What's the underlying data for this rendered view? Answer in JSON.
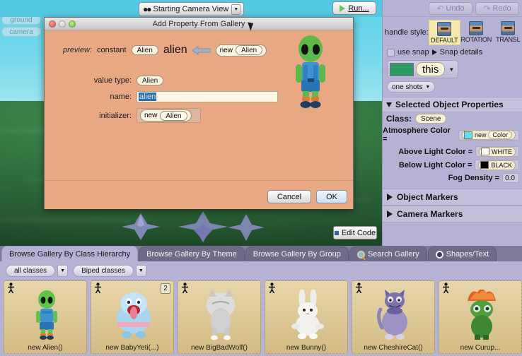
{
  "scene": {
    "object_tree": [
      {
        "label": "this",
        "active": true
      },
      {
        "label": "ground",
        "active": false
      },
      {
        "label": "camera",
        "active": false
      }
    ],
    "camera_view_label": "Starting Camera View",
    "camera_icon": "binoculars-icon",
    "run_label": "Run...",
    "run_icon": "play-triangle-icon",
    "edit_code_label": "Edit Code",
    "ground_color": "#2f6b3c",
    "sky_color": "#63d4e8",
    "prop_color": "#8e90c8"
  },
  "right_panel": {
    "undo_label": "Undo",
    "redo_label": "Redo",
    "undo_icon": "undo-arrow-icon",
    "redo_icon": "redo-arrow-icon",
    "handle_style_label": "handle style:",
    "handle_styles": [
      {
        "label": "DEFAULT",
        "selected": true
      },
      {
        "label": "ROTATION",
        "selected": false
      },
      {
        "label": "TRANSL",
        "selected": false
      }
    ],
    "use_snap_label": "use snap",
    "snap_details_label": "Snap details",
    "this_label": "this",
    "this_swatch": "#2f9a62",
    "one_shots_label": "one shots",
    "selected_object_properties_label": "Selected Object Properties",
    "class_label": "Class:",
    "class_value": "Scene",
    "properties": [
      {
        "label": "Atmosphere Color =",
        "kind": "color_new",
        "swatch": "#66dcf4",
        "value": "new",
        "sub": "Color"
      },
      {
        "label": "Above Light Color =",
        "kind": "color",
        "swatch": "#ffffff",
        "value": "WHITE"
      },
      {
        "label": "Below Light Color =",
        "kind": "color",
        "swatch": "#000000",
        "value": "BLACK"
      },
      {
        "label": "Fog Density =",
        "kind": "number",
        "value": "0.0"
      }
    ],
    "collapsed_sections": [
      "Object Markers",
      "Camera Markers"
    ]
  },
  "gallery": {
    "tabs": [
      {
        "label": "Browse Gallery By Class Hierarchy",
        "active": true,
        "icon": null
      },
      {
        "label": "Browse Gallery By Theme",
        "active": false,
        "icon": null
      },
      {
        "label": "Browse Gallery By Group",
        "active": false,
        "icon": null
      },
      {
        "label": "Search Gallery",
        "active": false,
        "icon": "search-icon"
      },
      {
        "label": "Shapes/Text",
        "active": false,
        "icon": "shapes-icon"
      }
    ],
    "filters": [
      {
        "label": "all classes"
      },
      {
        "label": "Biped classes"
      }
    ],
    "cards": [
      {
        "label": "new Alien()",
        "badge": "person-icon",
        "count": null,
        "body": "#56b84a",
        "accent": "#2f7fc4"
      },
      {
        "label": "new BabyYeti(...)",
        "badge": "person-icon",
        "count": "2",
        "body": "#a9d6ef",
        "accent": "#e7a0b8"
      },
      {
        "label": "new BigBadWolf()",
        "badge": "person-icon",
        "count": null,
        "body": "#d8d8d8",
        "accent": "#9a9a9a"
      },
      {
        "label": "new Bunny()",
        "badge": "person-icon",
        "count": null,
        "body": "#f2f0ec",
        "accent": "#cfc9c2"
      },
      {
        "label": "new CheshireCat()",
        "badge": "person-icon",
        "count": null,
        "body": "#9c8fc4",
        "accent": "#5d5390"
      },
      {
        "label": "new Curup...",
        "badge": "person-icon",
        "count": null,
        "body": "#4f9e3f",
        "accent": "#e06a2a"
      }
    ]
  },
  "dialog": {
    "title": "Add Property From Gallery",
    "traffic_lights": [
      "close-button",
      "minimize-button",
      "zoom-button"
    ],
    "preview_label": "preview:",
    "preview_keyword": "constant",
    "preview_type": "Alien",
    "preview_name": "alien",
    "preview_arrow": "left-arrow-icon",
    "preview_new_keyword": "new",
    "preview_new_type": "Alien",
    "value_type_label": "value type:",
    "value_type_value": "Alien",
    "name_label": "name:",
    "name_value": "alien",
    "initializer_label": "initializer:",
    "initializer_new": "new",
    "initializer_type": "Alien",
    "cancel_label": "Cancel",
    "ok_label": "OK"
  }
}
